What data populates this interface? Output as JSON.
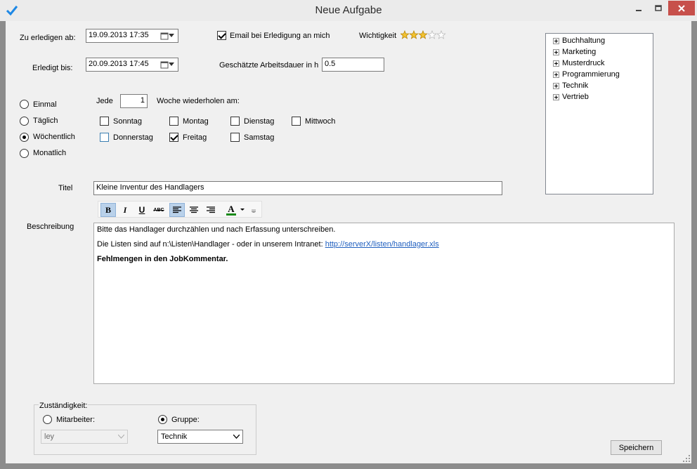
{
  "window": {
    "title": "Neue Aufgabe"
  },
  "schedule": {
    "due_from_label": "Zu erledigen ab:",
    "due_from_value": "19.09.2013 17:35",
    "done_by_label": "Erledigt bis:",
    "done_by_value": "20.09.2013 17:45",
    "email_label": "Email bei Erledigung an mich",
    "email_checked": true,
    "importance_label": "Wichtigkeit",
    "importance_stars": 3,
    "importance_max": 5,
    "duration_label": "Geschätzte Arbeitsdauer in h",
    "duration_value": "0.5"
  },
  "recurrence": {
    "options": [
      "Einmal",
      "Täglich",
      "Wöchentlich",
      "Monatlich"
    ],
    "selected": "Wöchentlich",
    "every_label": "Jede",
    "every_value": "1",
    "week_label": "Woche wiederholen am:",
    "days": [
      {
        "label": "Sonntag",
        "checked": false
      },
      {
        "label": "Montag",
        "checked": false
      },
      {
        "label": "Dienstag",
        "checked": false
      },
      {
        "label": "Mittwoch",
        "checked": false
      },
      {
        "label": "Donnerstag",
        "checked": false
      },
      {
        "label": "Freitag",
        "checked": true
      },
      {
        "label": "Samstag",
        "checked": false
      }
    ]
  },
  "categories": [
    "Buchhaltung",
    "Marketing",
    "Musterdruck",
    "Programmierung",
    "Technik",
    "Vertrieb"
  ],
  "task": {
    "title_label": "Titel",
    "title_value": "Kleine Inventur des Handlagers",
    "description_label": "Beschreibung",
    "description_line1": "Bitte das Handlager durchzählen und nach Erfassung unterschreiben.",
    "description_line2": "Die Listen sind auf n:\\Listen\\Handlager - oder in unserem Intranet:",
    "description_link": "http://serverX/listen/handlager.xls",
    "description_line3": "Fehlmengen in den JobKommentar."
  },
  "toolbar": {
    "bold": "B",
    "italic": "I",
    "underline": "U",
    "strike": "ABC",
    "font_color": "A"
  },
  "responsibility": {
    "group_label": "Zuständigkeit:",
    "employee_label": "Mitarbeiter:",
    "employee_value": "ley",
    "group_option_label": "Gruppe:",
    "group_value": "Technik",
    "selected": "Gruppe"
  },
  "actions": {
    "save_label": "Speichern"
  },
  "colors": {
    "close_button": "#c7504b",
    "link": "#1f5fbf",
    "accent": "#0078d7",
    "star": "#f2c230"
  }
}
